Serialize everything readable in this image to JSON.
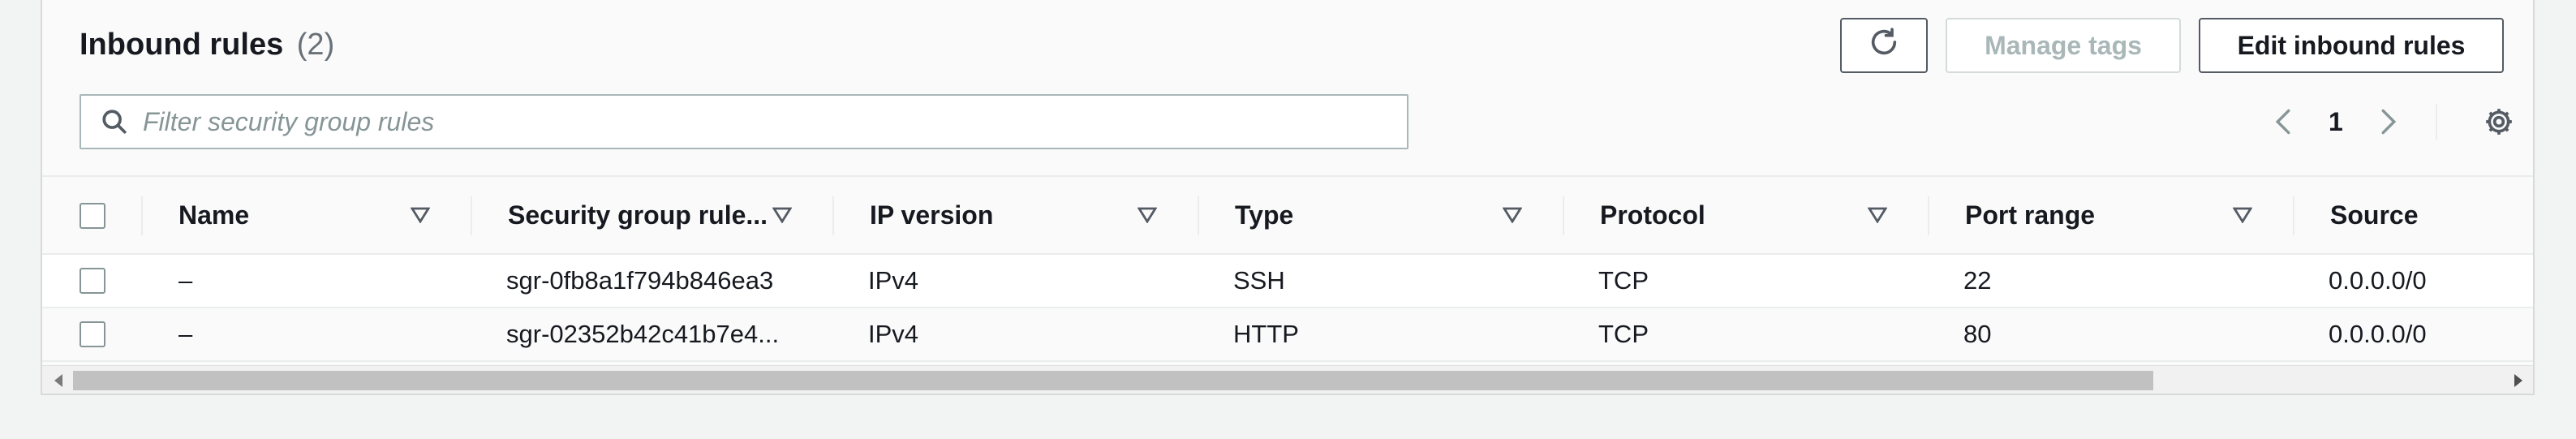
{
  "header": {
    "title": "Inbound rules",
    "count": "(2)"
  },
  "actions": {
    "refresh_icon": "refresh-icon",
    "manage_tags_label": "Manage tags",
    "edit_label": "Edit inbound rules"
  },
  "filter": {
    "placeholder": "Filter security group rules",
    "value": ""
  },
  "pagination": {
    "current_page": "1",
    "prev_icon": "chevron-left-icon",
    "next_icon": "chevron-right-icon",
    "settings_icon": "gear-icon"
  },
  "table": {
    "columns": [
      {
        "label": "Name"
      },
      {
        "label": "Security group rule..."
      },
      {
        "label": "IP version"
      },
      {
        "label": "Type"
      },
      {
        "label": "Protocol"
      },
      {
        "label": "Port range"
      },
      {
        "label": "Source"
      }
    ],
    "rows": [
      {
        "name": "–",
        "rule_id": "sgr-0fb8a1f794b846ea3",
        "ip_version": "IPv4",
        "type": "SSH",
        "protocol": "TCP",
        "port_range": "22",
        "source": "0.0.0.0/0"
      },
      {
        "name": "–",
        "rule_id": "sgr-02352b42c41b7e4...",
        "ip_version": "IPv4",
        "type": "HTTP",
        "protocol": "TCP",
        "port_range": "80",
        "source": "0.0.0.0/0"
      }
    ]
  },
  "colors": {
    "border": "#d5dbdb",
    "text": "#16191f",
    "muted": "#687078",
    "disabled": "#aab7b8"
  }
}
